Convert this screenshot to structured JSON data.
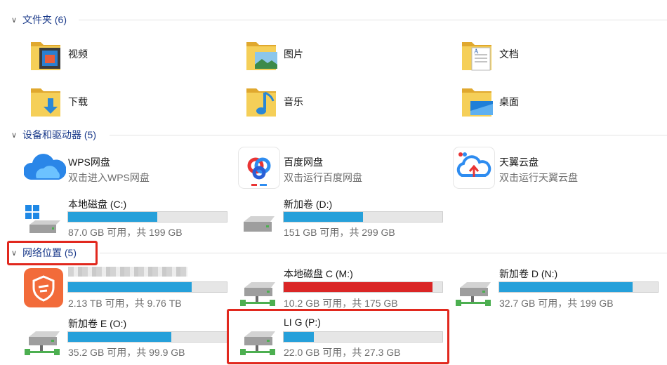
{
  "groups": {
    "folders": "文件夹 (6)",
    "devices": "设备和驱动器 (5)",
    "network": "网络位置 (5)"
  },
  "folders": [
    {
      "label": "视频",
      "icon": "video-folder-icon"
    },
    {
      "label": "图片",
      "icon": "pictures-folder-icon"
    },
    {
      "label": "文档",
      "icon": "documents-folder-icon"
    },
    {
      "label": "下载",
      "icon": "downloads-folder-icon"
    },
    {
      "label": "音乐",
      "icon": "music-folder-icon"
    },
    {
      "label": "桌面",
      "icon": "desktop-folder-icon"
    }
  ],
  "cloud": [
    {
      "title": "WPS网盘",
      "sub": "双击进入WPS网盘",
      "icon": "wps-cloud-icon"
    },
    {
      "title": "百度网盘",
      "sub": "双击运行百度网盘",
      "icon": "baidu-netdisk-icon"
    },
    {
      "title": "天翼云盘",
      "sub": "双击运行天翼云盘",
      "icon": "tianyi-cloud-icon"
    }
  ],
  "drives": [
    {
      "title": "本地磁盘 (C:)",
      "sub": "87.0 GB 可用，共 199 GB",
      "used": 0.56,
      "icon": "windows-drive-icon"
    },
    {
      "title": "新加卷 (D:)",
      "sub": "151 GB 可用，共 299 GB",
      "used": 0.5,
      "icon": "drive-icon"
    }
  ],
  "network": [
    {
      "title": "",
      "sub": "2.13 TB 可用，共 9.76 TB",
      "used": 0.78,
      "icon": "shield-app-icon",
      "status": "blue"
    },
    {
      "title": "本地磁盘 C (M:)",
      "sub": "10.2 GB 可用，共 175 GB",
      "used": 0.94,
      "icon": "network-drive-icon",
      "status": "red"
    },
    {
      "title": "新加卷 D (N:)",
      "sub": "32.7 GB 可用，共 199 GB",
      "used": 0.84,
      "icon": "network-drive-icon",
      "status": "blue"
    },
    {
      "title": "新加卷 E (O:)",
      "sub": "35.2 GB 可用，共 99.9 GB",
      "used": 0.65,
      "icon": "network-drive-icon",
      "status": "blue"
    },
    {
      "title": "LI G (P:)",
      "sub": "22.0 GB 可用，共 27.3 GB",
      "used": 0.19,
      "icon": "network-drive-icon",
      "status": "blue"
    }
  ],
  "colors": {
    "bar_blue": "#26a0da",
    "bar_red": "#da2626",
    "highlight": "#e1281e",
    "folder": "#f2c94c"
  }
}
